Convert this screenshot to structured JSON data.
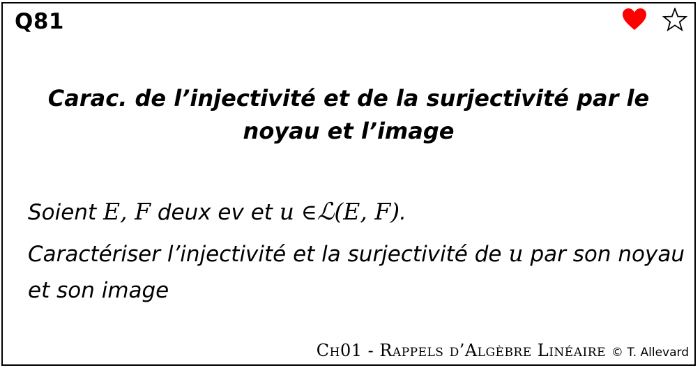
{
  "card": {
    "id": "Q81",
    "title": "Carac. de l’injectivité et de la surjectivité par le noyau et l’image",
    "statement": {
      "prefix": "Soient",
      "vars": "E, F",
      "middle": "deux ev et",
      "u": "u",
      "in": "∈",
      "L": "ℒ",
      "args": "(E, F)",
      "end": ".",
      "q_before": "Caractériser l’injectivité et la surjectivité de",
      "q_u": "u",
      "q_after": "par son noyau et son image"
    },
    "footer": {
      "chapter": "Ch01 - Rappels d’Algèbre Linéaire",
      "author": "© T. Allevard"
    },
    "icons": {
      "favorite": "heart-icon",
      "star": "star-icon",
      "favorite_color": "#ff0000"
    }
  }
}
